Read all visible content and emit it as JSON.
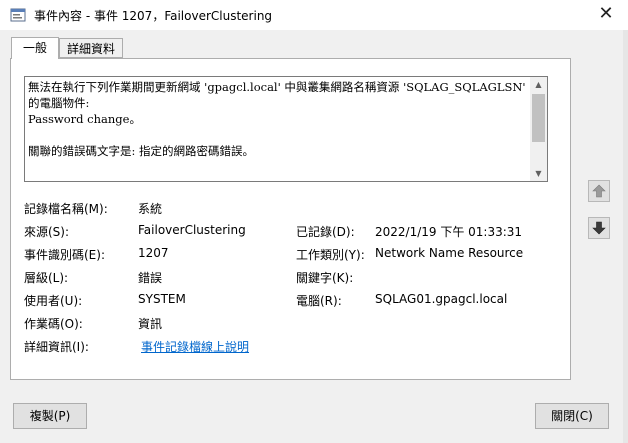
{
  "window": {
    "title": "事件內容 - 事件 1207，FailoverClustering",
    "close_glyph": "✕"
  },
  "tabs": [
    {
      "label": "一般",
      "active": true
    },
    {
      "label": "詳細資料",
      "active": false
    }
  ],
  "message": {
    "lines": [
      "無法在執行下列作業期間更新網域 'gpagcl.local' 中與叢集網路名稱資源 'SQLAG_SQLAGLSN' 關聯",
      "的電腦物件:",
      "Password change。",
      "",
      "關聯的錯誤碼文字是: 指定的網路密碼錯誤。"
    ]
  },
  "fields": {
    "log_name": {
      "label": "記錄檔名稱(M):",
      "value": "系統"
    },
    "source": {
      "label": "來源(S):",
      "value": "FailoverClustering"
    },
    "logged": {
      "label": "已記錄(D):",
      "value": "2022/1/19 下午 01:33:31"
    },
    "event_id": {
      "label": "事件識別碼(E):",
      "value": "1207"
    },
    "task_category": {
      "label": "工作類別(Y):",
      "value": "Network Name Resource"
    },
    "level": {
      "label": "層級(L):",
      "value": "錯誤"
    },
    "keywords": {
      "label": "關鍵字(K):",
      "value": ""
    },
    "user": {
      "label": "使用者(U):",
      "value": "SYSTEM"
    },
    "computer": {
      "label": "電腦(R):",
      "value": "SQLAG01.gpagcl.local"
    },
    "opcode": {
      "label": "作業碼(O):",
      "value": "資訊"
    },
    "more_info": {
      "label": "詳細資訊(I):",
      "link": "事件記錄檔線上說明"
    }
  },
  "buttons": {
    "copy": "複製(P)",
    "close": "關閉(C)"
  }
}
